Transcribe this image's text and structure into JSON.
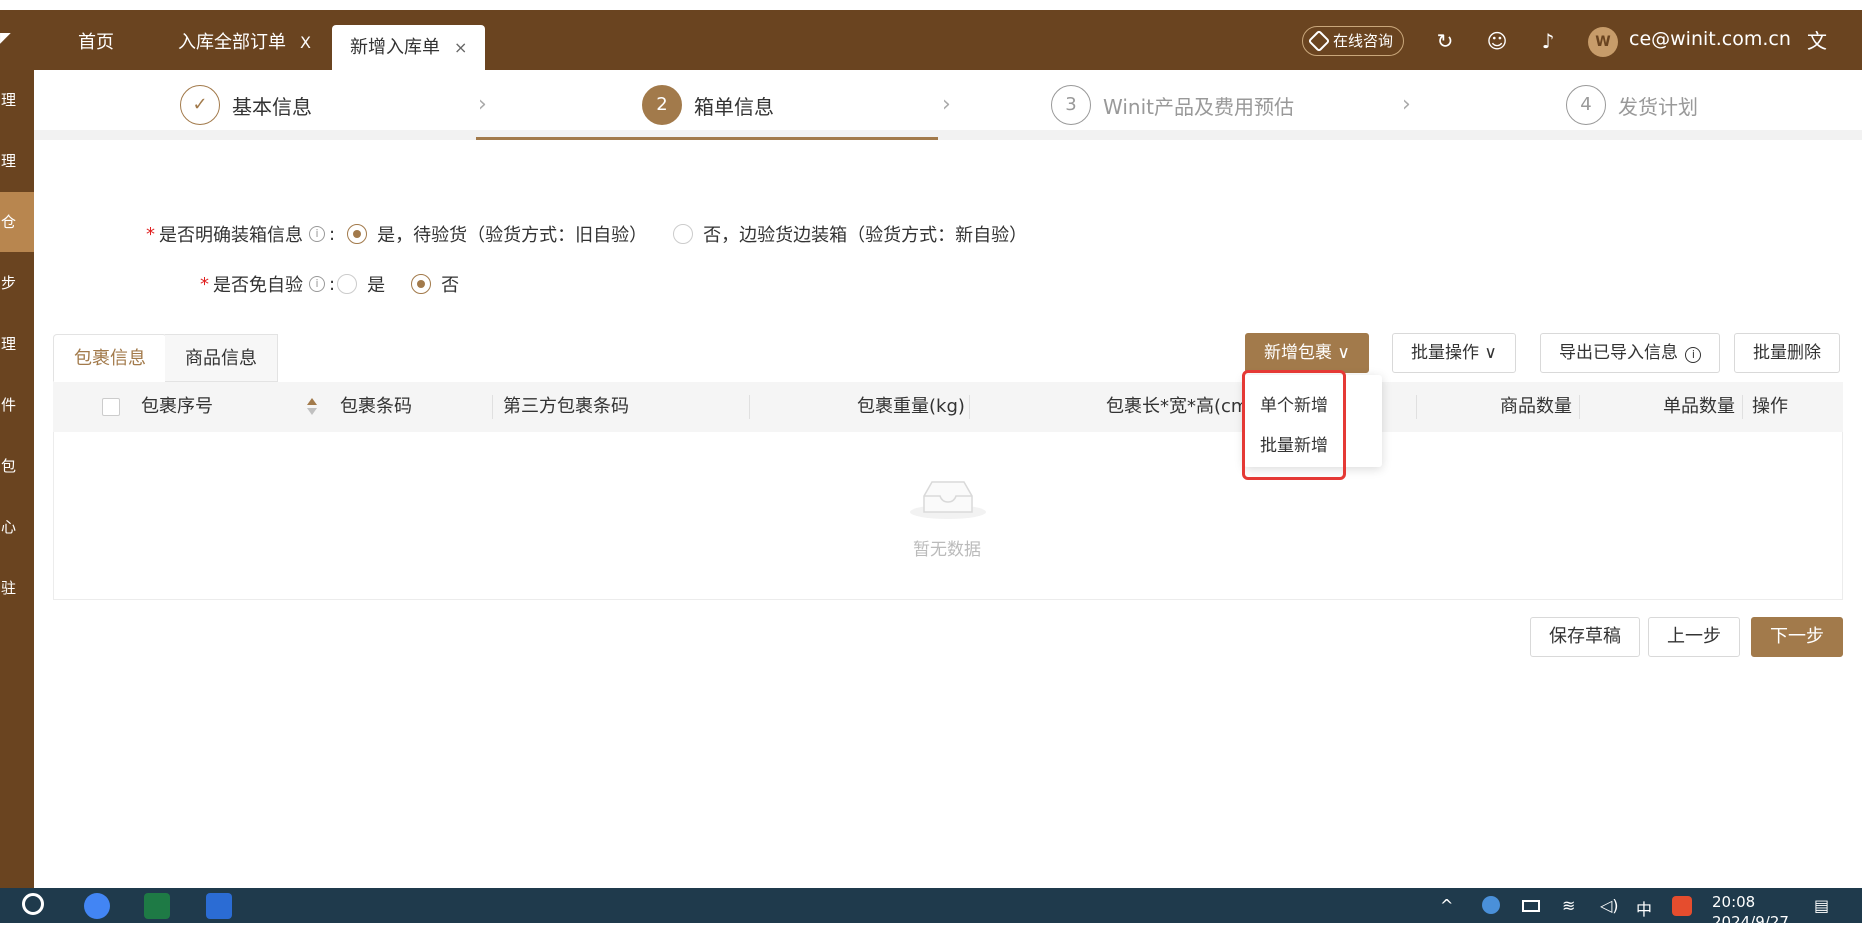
{
  "tabs": [
    {
      "label": "首页"
    },
    {
      "label": "入库全部订单",
      "close": "X"
    },
    {
      "label": "新增入库单",
      "close": "×"
    }
  ],
  "header": {
    "consult_label": "在线咨询",
    "user_email": "ce@winit.com.cn"
  },
  "sidebar": {
    "items": [
      "理",
      "理",
      "仓",
      "步",
      "理",
      "件",
      "包",
      "心",
      "驻"
    ]
  },
  "steps": [
    {
      "label": "基本信息",
      "marker": "✓",
      "status": "done"
    },
    {
      "label": "箱单信息",
      "marker": "2",
      "status": "current"
    },
    {
      "label": "Winit产品及费用预估",
      "marker": "3",
      "status": "pending"
    },
    {
      "label": "发货计划",
      "marker": "4",
      "status": "pending"
    }
  ],
  "form": {
    "q1": {
      "label": "是否明确装箱信息",
      "options": [
        "是，待验货（验货方式：旧自验）",
        "否，边验货边装箱（验货方式：新自验）"
      ],
      "selected": 0
    },
    "q2": {
      "label": "是否免自验",
      "options": [
        "是",
        "否"
      ],
      "selected": 1
    }
  },
  "subtabs": [
    "包裹信息",
    "商品信息"
  ],
  "toolbar": {
    "add_package": "新增包裹",
    "batch_ops": "批量操作",
    "export_imported": "导出已导入信息",
    "batch_delete": "批量删除"
  },
  "add_menu": [
    "单个新增",
    "批量新增"
  ],
  "table": {
    "columns": [
      "包裹序号",
      "包裹条码",
      "第三方包裹条码",
      "包裹重量(kg)",
      "包裹长*宽*高(cm)",
      "商品数量",
      "单品数量",
      "操作"
    ],
    "empty_text": "暂无数据"
  },
  "footer": {
    "save_draft": "保存草稿",
    "prev": "上一步",
    "next": "下一步"
  },
  "taskbar": {
    "ime": "中",
    "time": "20:08",
    "date": "2024/9/27"
  },
  "colors": {
    "brand": "#6a4420",
    "accent": "#a27a4b",
    "highlight": "#e53935"
  }
}
